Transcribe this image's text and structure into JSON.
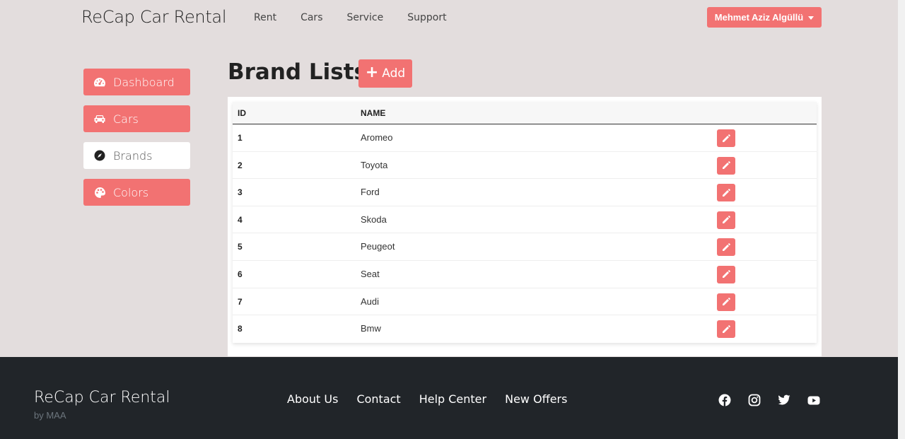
{
  "header": {
    "brand": "ReCap Car Rental",
    "nav": [
      "Rent",
      "Cars",
      "Service",
      "Support"
    ],
    "user_label": "Mehmet Aziz Algüllü"
  },
  "sidebar": {
    "items": [
      {
        "label": "Dashboard",
        "icon": "gauge-icon",
        "active": false
      },
      {
        "label": "Cars",
        "icon": "car-icon",
        "active": false
      },
      {
        "label": "Brands",
        "icon": "compass-icon",
        "active": true
      },
      {
        "label": "Colors",
        "icon": "palette-icon",
        "active": false
      }
    ]
  },
  "main": {
    "title": "Brand Lists",
    "add_label": "Add",
    "table": {
      "columns": [
        "ID",
        "NAME"
      ],
      "rows": [
        {
          "id": "1",
          "name": "Aromeo"
        },
        {
          "id": "2",
          "name": "Toyota"
        },
        {
          "id": "3",
          "name": "Ford"
        },
        {
          "id": "4",
          "name": "Skoda"
        },
        {
          "id": "5",
          "name": "Peugeot"
        },
        {
          "id": "6",
          "name": "Seat"
        },
        {
          "id": "7",
          "name": "Audi"
        },
        {
          "id": "8",
          "name": "Bmw"
        }
      ]
    }
  },
  "footer": {
    "brand": "ReCap Car Rental",
    "sub": "by MAA",
    "links": [
      "About Us",
      "Contact",
      "Help Center",
      "New Offers"
    ],
    "social": [
      "facebook-icon",
      "instagram-icon",
      "twitter-icon",
      "youtube-icon"
    ]
  },
  "colors": {
    "accent": "#f27272",
    "background": "#e3dddd",
    "footer": "#212529"
  }
}
